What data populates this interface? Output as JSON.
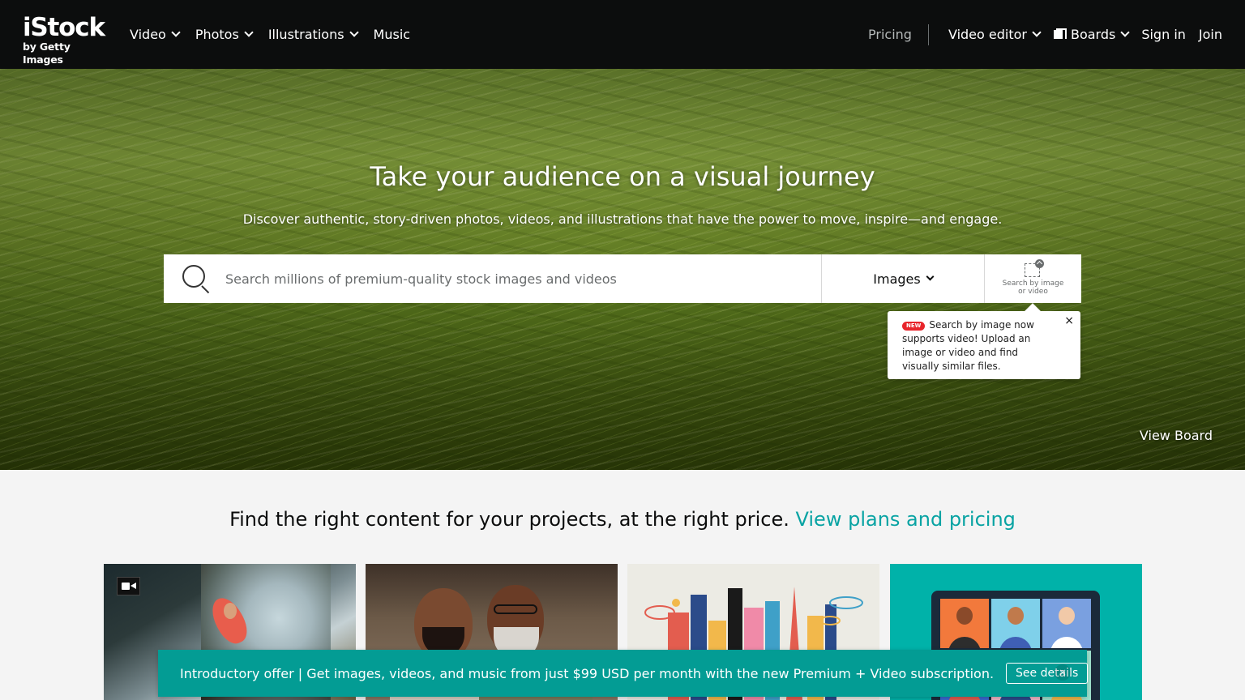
{
  "header": {
    "logo_main": "iStock",
    "logo_sub": "by Getty Images",
    "nav_left": [
      {
        "label": "Video"
      },
      {
        "label": "Photos"
      },
      {
        "label": "Illustrations"
      },
      {
        "label": "Music"
      }
    ],
    "pricing": "Pricing",
    "video_editor": "Video editor",
    "boards": "Boards",
    "sign_in": "Sign in",
    "join": "Join"
  },
  "hero": {
    "title": "Take your audience on a visual journey",
    "subtitle": "Discover authentic, story-driven photos, videos, and illustrations that have the power to move, inspire—and engage.",
    "search": {
      "placeholder": "Search millions of premium-quality stock images and videos",
      "media_type": "Images",
      "visual_search_label_1": "Search by image",
      "visual_search_label_2": "or video"
    },
    "tooltip": {
      "badge": "NEW",
      "text": "Search by image now supports video! Upload an image or video and find visually similar files.",
      "close": "×"
    },
    "view_board": "View Board"
  },
  "promo": {
    "text": "Find the right content for your projects, at the right price.",
    "link": "View plans and pricing"
  },
  "banner": {
    "text": "Introductory offer | Get images, videos, and music from just $99 USD per month with the new Premium + Video subscription.",
    "button": "See details",
    "close": "×"
  },
  "colors": {
    "header_bg": "#0c0d0d",
    "accent": "#08a3a3",
    "banner_bg": "#039c94",
    "badge_new": "#e8252b"
  }
}
